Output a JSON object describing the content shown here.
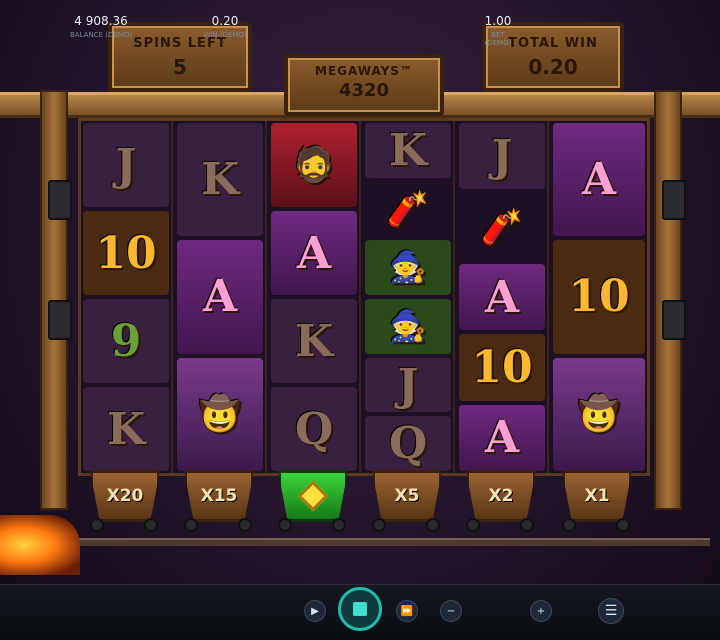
{
  "header": {
    "spins_left_label": "SPINS LEFT",
    "spins_left_value": "5",
    "megaways_label": "MEGAWAYS™",
    "megaways_value": "4320",
    "total_win_label": "TOTAL WIN",
    "total_win_value": "0.20"
  },
  "reels": [
    {
      "symbols": [
        "J",
        "10",
        "9",
        "K"
      ]
    },
    {
      "symbols": [
        "K",
        "A",
        "character-cowboy"
      ]
    },
    {
      "symbols": [
        "character-prospector",
        "A",
        "K",
        "Q"
      ]
    },
    {
      "symbols": [
        "K",
        "dynamite",
        "character-green-hat",
        "character-green-hat",
        "J",
        "Q"
      ]
    },
    {
      "symbols": [
        "J",
        "dynamite",
        "A",
        "10",
        "A"
      ]
    },
    {
      "symbols": [
        "A",
        "10",
        "character-cowboy"
      ]
    }
  ],
  "multipliers": [
    "X20",
    "X15",
    "coin",
    "X5",
    "X2",
    "X1"
  ],
  "footer": {
    "balance_value": "4 908.36",
    "balance_caption": "BALANCE (DEMO)",
    "win_value": "0.20",
    "win_caption": "WIN (DEMO)",
    "bet_value": "1.00",
    "bet_caption": "BET (DEMO)",
    "menu_icon": "hamburger-icon",
    "spin_icon": "stop-icon"
  },
  "colors": {
    "accent_teal": "#1fbfae",
    "active_cart": "#3ad43a",
    "wood": "#8a5c2c"
  }
}
